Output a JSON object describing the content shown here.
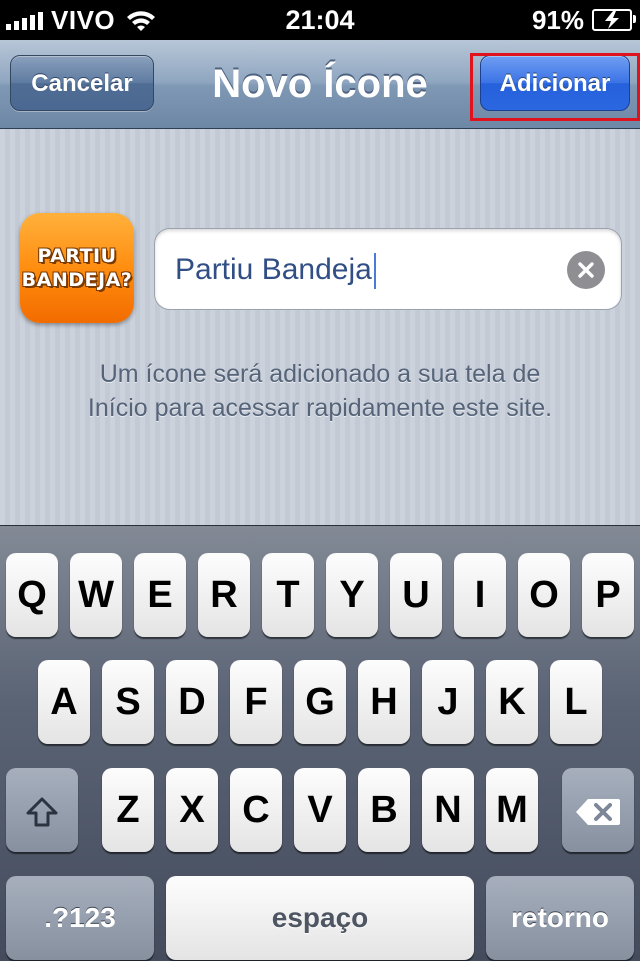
{
  "status_bar": {
    "carrier": "VIVO",
    "time": "21:04",
    "battery": "91%"
  },
  "nav": {
    "cancel_label": "Cancelar",
    "title": "Novo Ícone",
    "add_label": "Adicionar"
  },
  "app_icon": {
    "line1": "PARTIU",
    "line2": "BANDEJA?"
  },
  "name_field": {
    "value": "Partiu Bandeja"
  },
  "hint_line1": "Um ícone será adicionado a sua tela de",
  "hint_line2": "Início para acessar rapidamente este site.",
  "keyboard": {
    "row1": [
      "Q",
      "W",
      "E",
      "R",
      "T",
      "Y",
      "U",
      "I",
      "O",
      "P"
    ],
    "row2": [
      "A",
      "S",
      "D",
      "F",
      "G",
      "H",
      "J",
      "K",
      "L"
    ],
    "row3": [
      "Z",
      "X",
      "C",
      "V",
      "B",
      "N",
      "M"
    ],
    "numbers_label": ".?123",
    "space_label": "espaço",
    "return_label": "retorno"
  },
  "colors": {
    "add_button": "#2a67e0",
    "highlight_box": "#e0121c",
    "app_icon": "#ff8a0c"
  }
}
